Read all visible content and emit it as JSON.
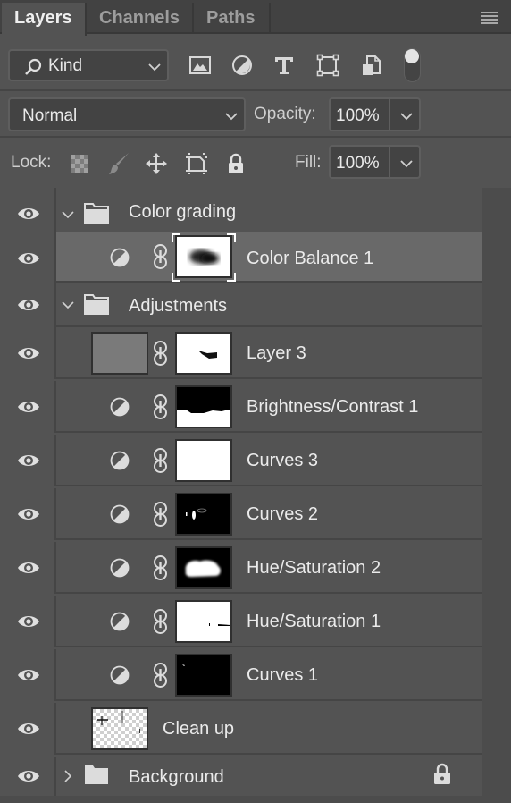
{
  "tabs": [
    {
      "label": "Layers",
      "active": true
    },
    {
      "label": "Channels",
      "active": false
    },
    {
      "label": "Paths",
      "active": false
    }
  ],
  "panel_menu_icon": "hamburger-menu-icon",
  "filter": {
    "kind_label": "Kind",
    "filter_icons": [
      "image-filter-icon",
      "adjustment-filter-icon",
      "type-filter-icon",
      "shape-filter-icon",
      "smart-object-filter-icon"
    ],
    "filter_toggle": "on"
  },
  "blend": {
    "mode": "Normal",
    "opacity_label": "Opacity:",
    "opacity_value": "100%"
  },
  "lock": {
    "label": "Lock:",
    "icons": [
      "lock-transparent-pixels-icon",
      "lock-image-pixels-icon",
      "lock-position-icon",
      "lock-artboard-icon",
      "lock-all-icon"
    ],
    "fill_label": "Fill:",
    "fill_value": "100%"
  },
  "colors": {
    "panel_bg": "#535353",
    "tab_bar_bg": "#424242",
    "selected_row": "#696969",
    "field_bg": "#434343",
    "text": "#ebebeb"
  },
  "layers": [
    {
      "name": "Color grading",
      "type": "group",
      "expanded": true,
      "visible": true,
      "indent": 0
    },
    {
      "name": "Color Balance 1",
      "type": "adjustment",
      "visible": true,
      "indent": 1,
      "selected": true,
      "mask": "blurred-dark-blob"
    },
    {
      "name": "Adjustments",
      "type": "group",
      "expanded": true,
      "visible": true,
      "indent": 0
    },
    {
      "name": "Layer 3",
      "type": "pixel",
      "visible": true,
      "indent": 1,
      "mask": "white-with-small-dark-marks"
    },
    {
      "name": "Brightness/Contrast 1",
      "type": "adjustment",
      "visible": true,
      "indent": 1,
      "mask": "black-top-white-bottom"
    },
    {
      "name": "Curves 3",
      "type": "adjustment",
      "visible": true,
      "indent": 1,
      "mask": "white"
    },
    {
      "name": "Curves 2",
      "type": "adjustment",
      "visible": true,
      "indent": 1,
      "mask": "black-with-small-white-marks"
    },
    {
      "name": "Hue/Saturation 2",
      "type": "adjustment",
      "visible": true,
      "indent": 1,
      "mask": "black-with-white-blob"
    },
    {
      "name": "Hue/Saturation 1",
      "type": "adjustment",
      "visible": true,
      "indent": 1,
      "mask": "white-with-small-black-marks"
    },
    {
      "name": "Curves 1",
      "type": "adjustment",
      "visible": true,
      "indent": 1,
      "mask": "black-with-tiny-white-mark"
    },
    {
      "name": "Clean up",
      "type": "pixel-transparent",
      "visible": true,
      "indent": 0
    },
    {
      "name": "Background",
      "type": "group",
      "expanded": false,
      "visible": true,
      "indent": 0,
      "locked": true
    }
  ]
}
